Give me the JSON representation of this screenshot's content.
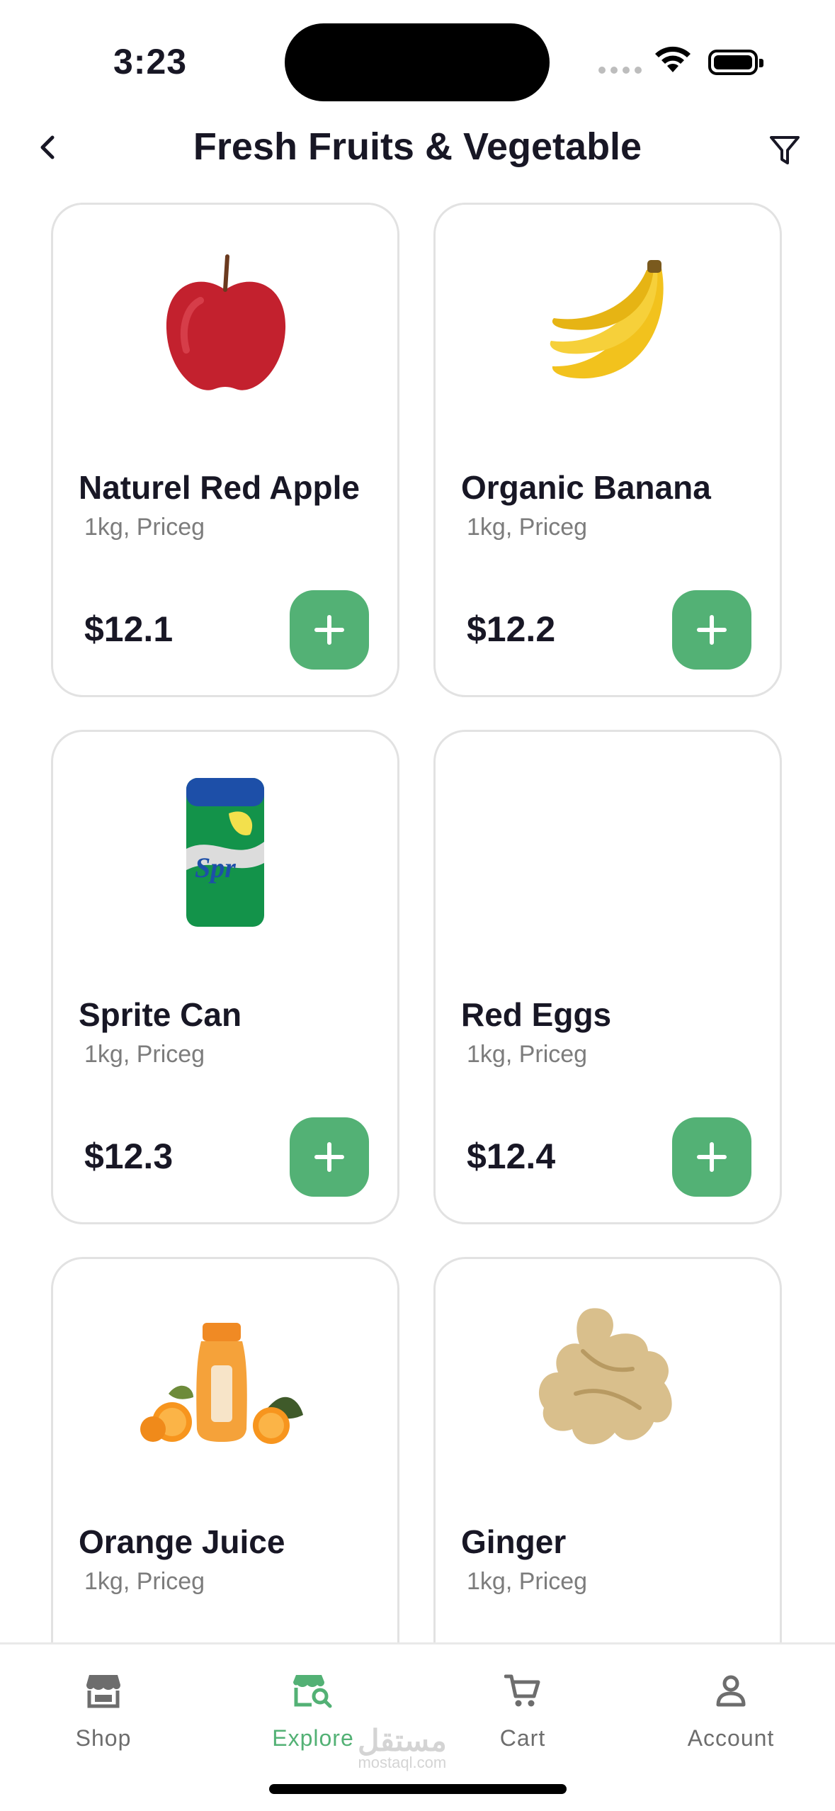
{
  "status_bar": {
    "time": "3:23"
  },
  "header": {
    "title": "Fresh Fruits & Vegetable"
  },
  "products": [
    {
      "name": "Naturel Red Apple",
      "unit": "1kg, Priceg",
      "price": "$12.1",
      "icon": "apple-image"
    },
    {
      "name": "Organic Banana",
      "unit": "1kg, Priceg",
      "price": "$12.2",
      "icon": "banana-image"
    },
    {
      "name": "Sprite Can",
      "unit": "1kg, Priceg",
      "price": "$12.3",
      "icon": "sprite-can-image"
    },
    {
      "name": "Red Eggs",
      "unit": "1kg, Priceg",
      "price": "$12.4",
      "icon": "eggs-image"
    },
    {
      "name": "Orange Juice",
      "unit": "1kg, Priceg",
      "price": "",
      "icon": "orange-juice-image"
    },
    {
      "name": "Ginger",
      "unit": "1kg, Priceg",
      "price": "",
      "icon": "ginger-image"
    }
  ],
  "bottom_nav": {
    "items": [
      {
        "label": "Shop",
        "icon": "shop-icon",
        "active": false
      },
      {
        "label": "Explore",
        "icon": "explore-icon",
        "active": true
      },
      {
        "label": "Cart",
        "icon": "cart-icon",
        "active": false
      },
      {
        "label": "Account",
        "icon": "account-icon",
        "active": false
      }
    ]
  },
  "watermark": {
    "arabic": "مستقل",
    "latin": "mostaql.com"
  },
  "colors": {
    "accent": "#53b175",
    "text": "#181725",
    "muted": "#7c7c7c",
    "border": "#e2e2e2"
  }
}
